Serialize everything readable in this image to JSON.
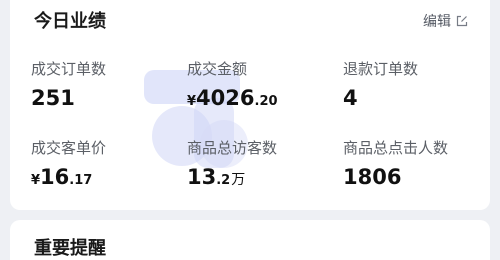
{
  "card": {
    "title": "今日业绩",
    "edit_label": "编辑",
    "metrics": [
      {
        "label": "成交订单数",
        "value": "251"
      },
      {
        "label": "成交金额",
        "currency": "¥",
        "int": "4026",
        "dec": ".20"
      },
      {
        "label": "退款订单数",
        "value": "4"
      },
      {
        "label": "成交客单价",
        "currency": "¥",
        "int": "16",
        "dec": ".17"
      },
      {
        "label": "商品总访客数",
        "int": "13",
        "dec": ".2",
        "unit": "万"
      },
      {
        "label": "商品总点击人数",
        "value": "1806"
      }
    ]
  },
  "next_section": {
    "title": "重要提醒"
  },
  "colors": {
    "background": "#eef0f4",
    "card": "#ffffff",
    "text": "#111111",
    "label": "#5b5f66"
  }
}
